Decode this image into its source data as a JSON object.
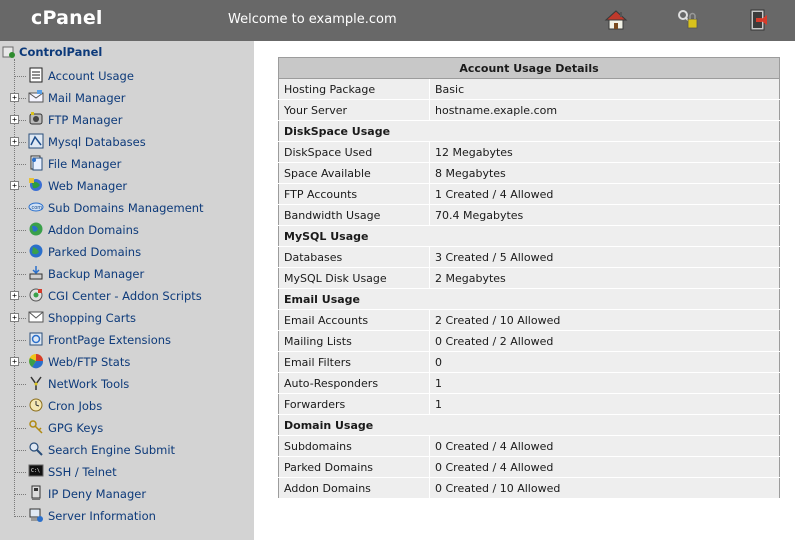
{
  "header": {
    "brand": "cPanel",
    "welcome": "Welcome to example.com",
    "icons": [
      "home-icon",
      "password-keys-icon",
      "logout-icon"
    ]
  },
  "sidebar": {
    "root_label": "ControlPanel",
    "items": [
      {
        "label": "Account Usage",
        "icon": "account-usage-icon",
        "expandable": false
      },
      {
        "label": "Mail Manager",
        "icon": "mail-icon",
        "expandable": true
      },
      {
        "label": "FTP Manager",
        "icon": "ftp-icon",
        "expandable": true
      },
      {
        "label": "Mysql Databases",
        "icon": "mysql-icon",
        "expandable": true
      },
      {
        "label": "File Manager",
        "icon": "file-manager-icon",
        "expandable": false
      },
      {
        "label": "Web Manager",
        "icon": "web-manager-icon",
        "expandable": true
      },
      {
        "label": "Sub Domains Management",
        "icon": "subdomain-icon",
        "expandable": false
      },
      {
        "label": "Addon Domains",
        "icon": "addon-domains-icon",
        "expandable": false
      },
      {
        "label": "Parked Domains",
        "icon": "parked-domains-icon",
        "expandable": false
      },
      {
        "label": "Backup Manager",
        "icon": "backup-icon",
        "expandable": false
      },
      {
        "label": "CGI Center - Addon Scripts",
        "icon": "cgi-icon",
        "expandable": true
      },
      {
        "label": "Shopping Carts",
        "icon": "shopping-cart-icon",
        "expandable": true
      },
      {
        "label": "FrontPage Extensions",
        "icon": "frontpage-icon",
        "expandable": false
      },
      {
        "label": "Web/FTP Stats",
        "icon": "stats-icon",
        "expandable": true
      },
      {
        "label": "NetWork Tools",
        "icon": "network-tools-icon",
        "expandable": false
      },
      {
        "label": "Cron Jobs",
        "icon": "cron-icon",
        "expandable": false
      },
      {
        "label": "GPG Keys",
        "icon": "gpg-keys-icon",
        "expandable": false
      },
      {
        "label": "Search Engine Submit",
        "icon": "search-engine-icon",
        "expandable": false
      },
      {
        "label": "SSH / Telnet",
        "icon": "terminal-icon",
        "expandable": false
      },
      {
        "label": "IP Deny Manager",
        "icon": "ip-deny-icon",
        "expandable": false
      },
      {
        "label": "Server Information",
        "icon": "server-info-icon",
        "expandable": false
      }
    ]
  },
  "details": {
    "title": "Account Usage Details",
    "rows": [
      {
        "type": "pair",
        "key": "Hosting Package",
        "value": "Basic"
      },
      {
        "type": "pair",
        "key": "Your Server",
        "value": "hostname.exaple.com"
      },
      {
        "type": "section",
        "key": "DiskSpace Usage"
      },
      {
        "type": "pair",
        "key": "DiskSpace Used",
        "value": "12 Megabytes"
      },
      {
        "type": "pair",
        "key": "Space Available",
        "value": "8 Megabytes"
      },
      {
        "type": "pair",
        "key": "FTP Accounts",
        "value": "1 Created / 4 Allowed"
      },
      {
        "type": "pair",
        "key": "Bandwidth Usage",
        "value": "70.4 Megabytes"
      },
      {
        "type": "section",
        "key": "MySQL Usage"
      },
      {
        "type": "pair",
        "key": "Databases",
        "value": "3 Created / 5 Allowed"
      },
      {
        "type": "pair",
        "key": "MySQL Disk Usage",
        "value": "2 Megabytes"
      },
      {
        "type": "section",
        "key": "Email Usage"
      },
      {
        "type": "pair",
        "key": "Email Accounts",
        "value": "2 Created / 10 Allowed"
      },
      {
        "type": "pair",
        "key": "Mailing Lists",
        "value": "0 Created / 2 Allowed"
      },
      {
        "type": "pair",
        "key": "Email Filters",
        "value": "0"
      },
      {
        "type": "pair",
        "key": "Auto-Responders",
        "value": "1"
      },
      {
        "type": "pair",
        "key": "Forwarders",
        "value": "1"
      },
      {
        "type": "section",
        "key": "Domain Usage"
      },
      {
        "type": "pair",
        "key": "Subdomains",
        "value": "0 Created / 4 Allowed"
      },
      {
        "type": "pair",
        "key": "Parked Domains",
        "value": "0 Created / 4 Allowed"
      },
      {
        "type": "pair",
        "key": "Addon Domains",
        "value": "0 Created / 10 Allowed"
      }
    ]
  }
}
